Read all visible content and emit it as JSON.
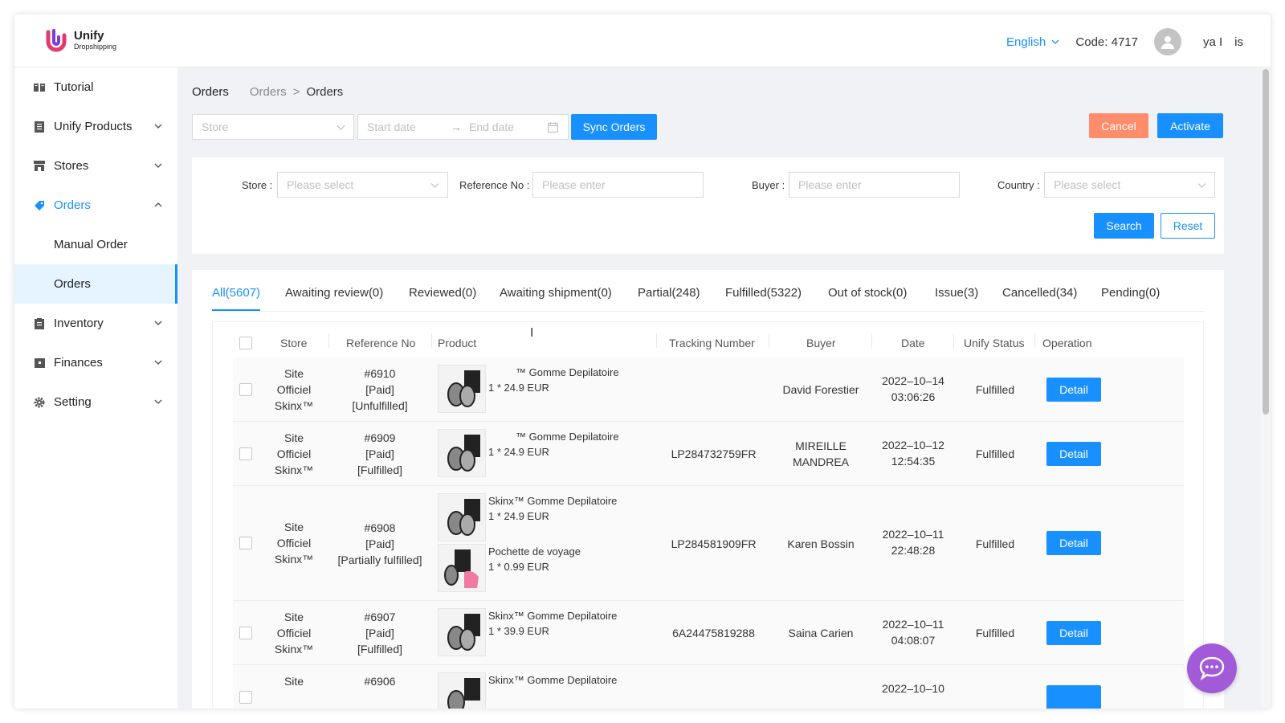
{
  "app": {
    "name": "Unify",
    "sub": "Dropshipping",
    "brand_color": "#1890ff"
  },
  "header": {
    "language": "English",
    "code": "Code: 4717",
    "username": " ya I is"
  },
  "sidebar": {
    "items": [
      {
        "label": "Tutorial",
        "icon": "book-icon"
      },
      {
        "label": "Unify Products",
        "icon": "list-icon"
      },
      {
        "label": "Stores",
        "icon": "store-icon"
      },
      {
        "label": "Orders",
        "icon": "tag-icon"
      },
      {
        "label": "Inventory",
        "icon": "clipboard-icon"
      },
      {
        "label": "Finances",
        "icon": "wallet-icon"
      },
      {
        "label": "Setting",
        "icon": "gear-icon"
      }
    ],
    "orders_sub": [
      "Manual Order",
      "Orders"
    ]
  },
  "breadcrumb": {
    "title": "Orders",
    "link": "Orders",
    "sep": ">",
    "current": "Orders"
  },
  "toolbar": {
    "store_placeholder": "Store",
    "start_date": "Start date",
    "arrow": "→",
    "end_date": "End date",
    "sync_label": "Sync Orders",
    "cancel_label": "Cancel",
    "activate_label": "Activate"
  },
  "filter": {
    "store_label": "Store :",
    "store_placeholder": "Please select",
    "ref_label": "Reference No :",
    "ref_placeholder": "Please enter",
    "buyer_label": "Buyer :",
    "buyer_placeholder": "Please enter",
    "country_label": "Country :",
    "country_placeholder": "Please select",
    "search_label": "Search",
    "reset_label": "Reset"
  },
  "tabs": [
    "All(5607)",
    "Awaiting review(0)",
    "Reviewed(0)",
    "Awaiting shipment(0)",
    "Partial(248)",
    "Fulfilled(5322)",
    "Out of stock(0)",
    "Issue(3)",
    "Cancelled(34)",
    "Pending(0)"
  ],
  "table": {
    "columns": [
      "Store",
      "Reference No",
      "Product",
      "Tracking Number",
      "Buyer",
      "Date",
      "Unify Status",
      "Operation"
    ],
    "detail_label": "Detail",
    "rows": [
      {
        "store": [
          "Site",
          "Officiel",
          "Skinx™"
        ],
        "ref": [
          "#6910",
          "[Paid]",
          "[Unfulfilled]"
        ],
        "products": [
          {
            "name": "™ Gomme Depilatoire",
            "qty": "1 * 24.9 EUR"
          }
        ],
        "tracking": "",
        "buyer": [
          "David Forestier"
        ],
        "date": [
          "2022–10–14",
          "03:06:26"
        ],
        "status": "Fulfilled"
      },
      {
        "store": [
          "Site",
          "Officiel",
          "Skinx™"
        ],
        "ref": [
          "#6909",
          "[Paid]",
          "[Fulfilled]"
        ],
        "products": [
          {
            "name": "™ Gomme Depilatoire",
            "qty": "1 * 24.9 EUR"
          }
        ],
        "tracking": "LP284732759FR",
        "buyer": [
          "MIREILLE",
          "MANDREA"
        ],
        "date": [
          "2022–10–12",
          "12:54:35"
        ],
        "status": "Fulfilled"
      },
      {
        "store": [
          "Site",
          "Officiel",
          "Skinx™"
        ],
        "ref": [
          "#6908",
          "[Paid]",
          "[Partially fulfilled]"
        ],
        "products": [
          {
            "name": "Skinx™ Gomme Depilatoire",
            "qty": "1 * 24.9 EUR"
          },
          {
            "name": "Pochette de voyage",
            "qty": "1 * 0.99 EUR"
          }
        ],
        "tracking": "LP284581909FR",
        "buyer": [
          "Karen Bossin"
        ],
        "date": [
          "2022–10–11",
          "22:48:28"
        ],
        "status": "Fulfilled"
      },
      {
        "store": [
          "Site",
          "Officiel",
          "Skinx™"
        ],
        "ref": [
          "#6907",
          "[Paid]",
          "[Fulfilled]"
        ],
        "products": [
          {
            "name": "Skinx™ Gomme Depilatoire",
            "qty": "1 * 39.9 EUR"
          }
        ],
        "tracking": "6A24475819288",
        "buyer": [
          "Saina Carien"
        ],
        "date": [
          "2022–10–11",
          "04:08:07"
        ],
        "status": "Fulfilled"
      },
      {
        "store": [
          "Site"
        ],
        "ref": [
          "#6906"
        ],
        "products": [
          {
            "name": "Skinx™ Gomme Depilatoire",
            "qty": ""
          }
        ],
        "tracking": "",
        "buyer": [],
        "date": [
          "2022–10–10"
        ],
        "status": ""
      }
    ]
  },
  "colors": {
    "primary": "#1890ff",
    "cancel": "#ff8c6b",
    "chat": "#a25ad9"
  }
}
